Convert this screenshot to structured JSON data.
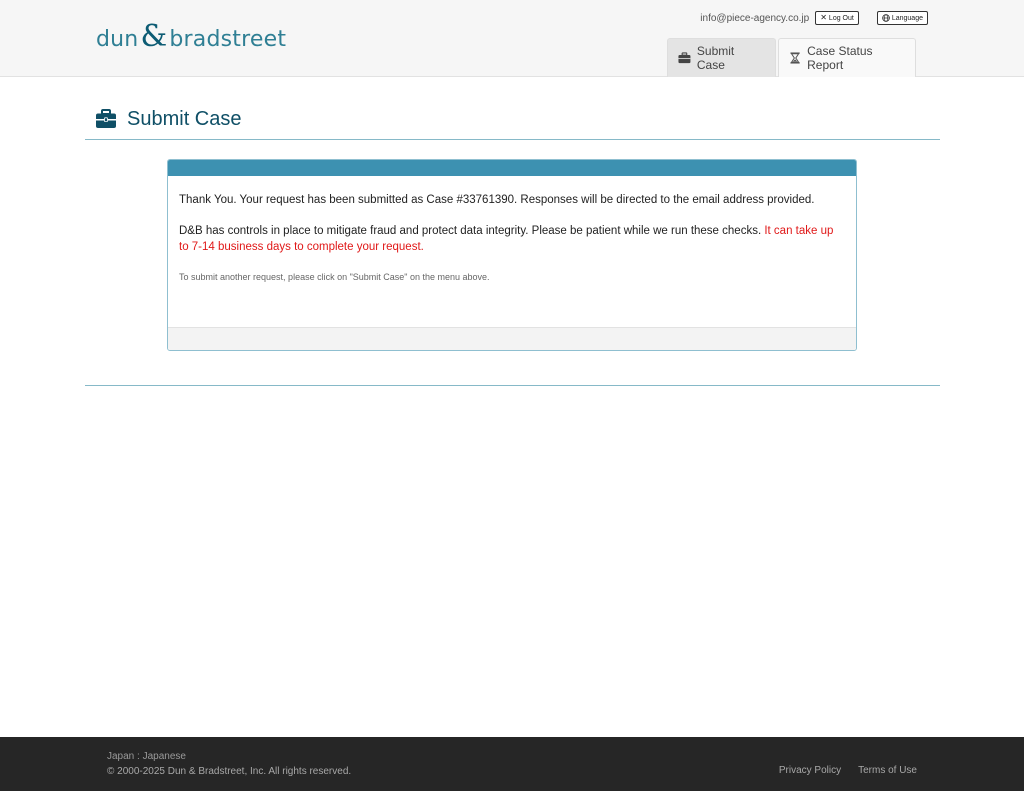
{
  "brand": {
    "logo_left": "dun",
    "logo_amp": "&",
    "logo_right": "bradstreet",
    "logo_color": "#2f7f94"
  },
  "user_bar": {
    "email": "info@piece-agency.co.jp",
    "logout_icon": "x-icon",
    "logout_label": "Log Out",
    "language_icon": "globe-icon",
    "language_label": "Language"
  },
  "tabs": [
    {
      "label": "Submit Case",
      "icon": "briefcase-icon",
      "active": true
    },
    {
      "label": "Case Status Report",
      "icon": "hourglass-icon",
      "active": false
    }
  ],
  "page": {
    "title": "Submit Case",
    "title_icon": "briefcase-icon",
    "title_color": "#0f4f66"
  },
  "confirmation": {
    "message": "Thank You. Your request has been submitted as Case #33761390. Responses will be directed to the email address provided.",
    "controls_text": "D&B has controls in place to mitigate fraud and protect data integrity. Please be patient while we run these checks. ",
    "warning_text": "It can take up to 7-14 business days to complete your request.",
    "warning_color": "#e01818",
    "hint": "To submit another request, please click on \"Submit Case\" on the menu above.",
    "header_color": "#3d91b1"
  },
  "footer": {
    "region": "Japan : Japanese",
    "copyright": "© 2000-2025 Dun & Bradstreet, Inc. All rights reserved.",
    "links": [
      "Privacy Policy",
      "Terms of Use"
    ]
  }
}
